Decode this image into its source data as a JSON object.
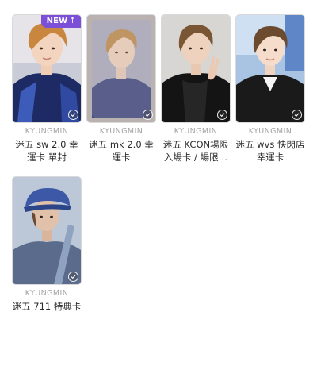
{
  "cards": [
    {
      "member": "KYUNGMIN",
      "title": "迷五 sw 2.0 幸運卡 單封",
      "badge": "NEW",
      "badge_icon": "arrow-up-icon",
      "selected": true
    },
    {
      "member": "KYUNGMIN",
      "title": "迷五 mk 2.0 幸運卡",
      "selected": true
    },
    {
      "member": "KYUNGMIN",
      "title": "迷五 KCON場限入場卡 / 場限…",
      "selected": true
    },
    {
      "member": "KYUNGMIN",
      "title": "迷五 wvs 快閃店 幸運卡",
      "selected": true
    },
    {
      "member": "KYUNGMIN",
      "title": "迷五 711 特典卡",
      "selected": true
    }
  ],
  "colors": {
    "badge": "#7b4fd8",
    "member_text": "#a3a3a3",
    "title_text": "#2b2b2b"
  }
}
